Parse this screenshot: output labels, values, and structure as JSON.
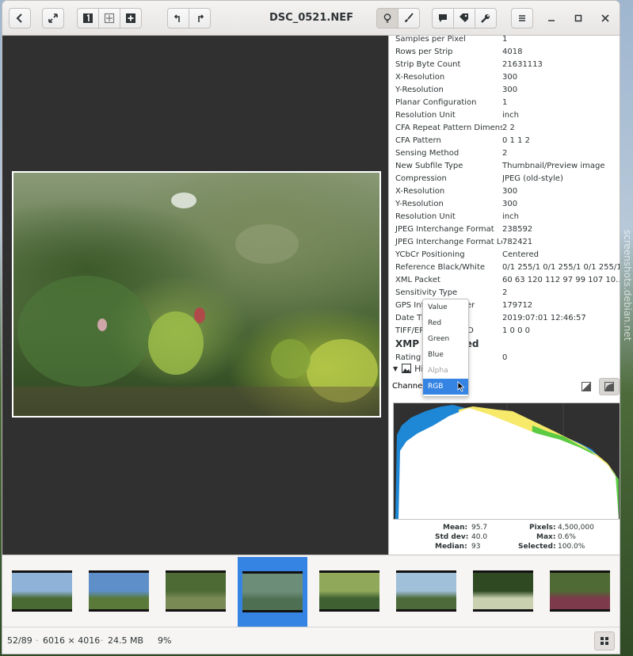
{
  "window": {
    "title": "DSC_0521.NEF"
  },
  "metadata": [
    {
      "k": "Samples per Pixel",
      "v": "1"
    },
    {
      "k": "Rows per Strip",
      "v": "4018"
    },
    {
      "k": "Strip Byte Count",
      "v": "21631113"
    },
    {
      "k": "X-Resolution",
      "v": "300"
    },
    {
      "k": "Y-Resolution",
      "v": "300"
    },
    {
      "k": "Planar Configuration",
      "v": "1"
    },
    {
      "k": "Resolution Unit",
      "v": "inch"
    },
    {
      "k": "CFA Repeat Pattern Dimensi...",
      "v": "2 2"
    },
    {
      "k": "CFA Pattern",
      "v": "0 1 1 2"
    },
    {
      "k": "Sensing Method",
      "v": "2"
    },
    {
      "k": "New Subfile Type",
      "v": "Thumbnail/Preview image"
    },
    {
      "k": "Compression",
      "v": "JPEG (old-style)"
    },
    {
      "k": "X-Resolution",
      "v": "300"
    },
    {
      "k": "Y-Resolution",
      "v": "300"
    },
    {
      "k": "Resolution Unit",
      "v": "inch"
    },
    {
      "k": "JPEG Interchange Format",
      "v": "238592"
    },
    {
      "k": "JPEG Interchange Format Le...",
      "v": "782421"
    },
    {
      "k": "YCbCr Positioning",
      "v": "Centered"
    },
    {
      "k": "Reference Black/White",
      "v": "0/1 255/1 0/1 255/1 0/1 255/1"
    },
    {
      "k": "XML Packet",
      "v": "60 63 120 112 97 99 107 10..."
    },
    {
      "k": "Sensitivity Type",
      "v": "2"
    },
    {
      "k": "GPS Info IFD Pointer",
      "v": "179712"
    },
    {
      "k": "Date Time",
      "v": "2019:07:01 12:46:57"
    },
    {
      "k": "TIFF/EP Standard ID",
      "v": "1 0 0 0"
    }
  ],
  "xmp": {
    "title": "XMP Embedded",
    "rows": [
      {
        "k": "Rating",
        "v": "0"
      }
    ]
  },
  "histogram": {
    "header": "Histogram",
    "channel_label": "Channel:",
    "dropdown_options": [
      {
        "label": "Value",
        "state": "normal"
      },
      {
        "label": "Red",
        "state": "normal"
      },
      {
        "label": "Green",
        "state": "normal"
      },
      {
        "label": "Blue",
        "state": "normal"
      },
      {
        "label": "Alpha",
        "state": "disabled"
      },
      {
        "label": "RGB",
        "state": "selected"
      }
    ],
    "stats": {
      "mean_label": "Mean:",
      "mean": "95.7",
      "std_label": "Std dev:",
      "std": "40.0",
      "median_label": "Median:",
      "median": "93",
      "pixels_label": "Pixels:",
      "pixels": "4,500,000",
      "max_label": "Max:",
      "max": "0.6%",
      "selected_label": "Selected:",
      "selected": "100.0%"
    }
  },
  "filmstrip": {
    "selected_index": 3,
    "thumbs": [
      {
        "c1": "#8fb3d8",
        "c2": "#4a6a34"
      },
      {
        "c1": "#5f8fc8",
        "c2": "#5a7a3a"
      },
      {
        "c1": "#4d6a35",
        "c2": "#7a8a55"
      },
      {
        "c1": "#6c8d78",
        "c2": "#4f6f52"
      },
      {
        "c1": "#8fa85a",
        "c2": "#3f6030"
      },
      {
        "c1": "#9fc0d8",
        "c2": "#4d6a3a"
      },
      {
        "c1": "#2f4a22",
        "c2": "#c9d0b0"
      },
      {
        "c1": "#4f6a34",
        "c2": "#7c3a4a"
      }
    ]
  },
  "status": {
    "position": "52/89",
    "dimensions": "6016 × 4016",
    "filesize": "24.5 MB",
    "zoom": "9%"
  },
  "watermark": "screenshots.debian.net",
  "colors": {
    "accent": "#3584e4",
    "viewer_bg": "#303030"
  }
}
